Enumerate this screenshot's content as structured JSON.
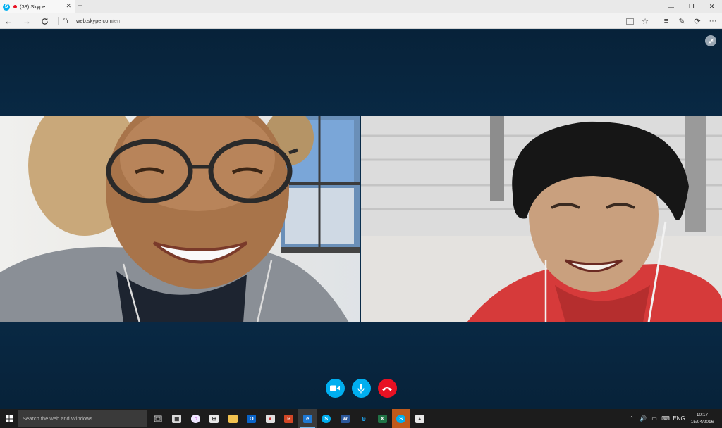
{
  "browser": {
    "tab_title": "(38) Skype",
    "favicon_letter": "S",
    "url_host": "web.skype.com",
    "url_path": "/en"
  },
  "call": {
    "participants": [
      {
        "position": "left",
        "description": "woman with glasses smiling"
      },
      {
        "position": "right",
        "description": "boy in red hoodie laughing"
      }
    ],
    "controls": [
      "video-toggle",
      "mute-toggle",
      "end-call"
    ]
  },
  "taskbar": {
    "search_placeholder": "Search the web and Windows",
    "language": "ENG",
    "time": "10:17",
    "date": "15/04/2016",
    "apps": [
      {
        "name": "task-view",
        "color": "#1c1c1c"
      },
      {
        "name": "calculator",
        "color": "#d9d9d9"
      },
      {
        "name": "itunes",
        "color": "#e8e8ff"
      },
      {
        "name": "store",
        "color": "#e8e8e8"
      },
      {
        "name": "file-explorer",
        "color": "#f2c24f"
      },
      {
        "name": "outlook",
        "color": "#0a64c8"
      },
      {
        "name": "paint",
        "color": "#e0e0e0"
      },
      {
        "name": "powerpoint",
        "color": "#d24726"
      },
      {
        "name": "edge",
        "color": "#1e78d2"
      },
      {
        "name": "skype-app",
        "color": "#00aff0"
      },
      {
        "name": "word",
        "color": "#2b579a"
      },
      {
        "name": "internet-explorer",
        "color": "#1ea0e6"
      },
      {
        "name": "excel",
        "color": "#217346"
      },
      {
        "name": "skype-for-business",
        "color": "#00aff0"
      },
      {
        "name": "photos",
        "color": "#e8e8e8"
      }
    ]
  },
  "colors": {
    "stage_bg": "#0b3050",
    "accent_blue": "#00aff0",
    "end_call_red": "#e81123"
  }
}
